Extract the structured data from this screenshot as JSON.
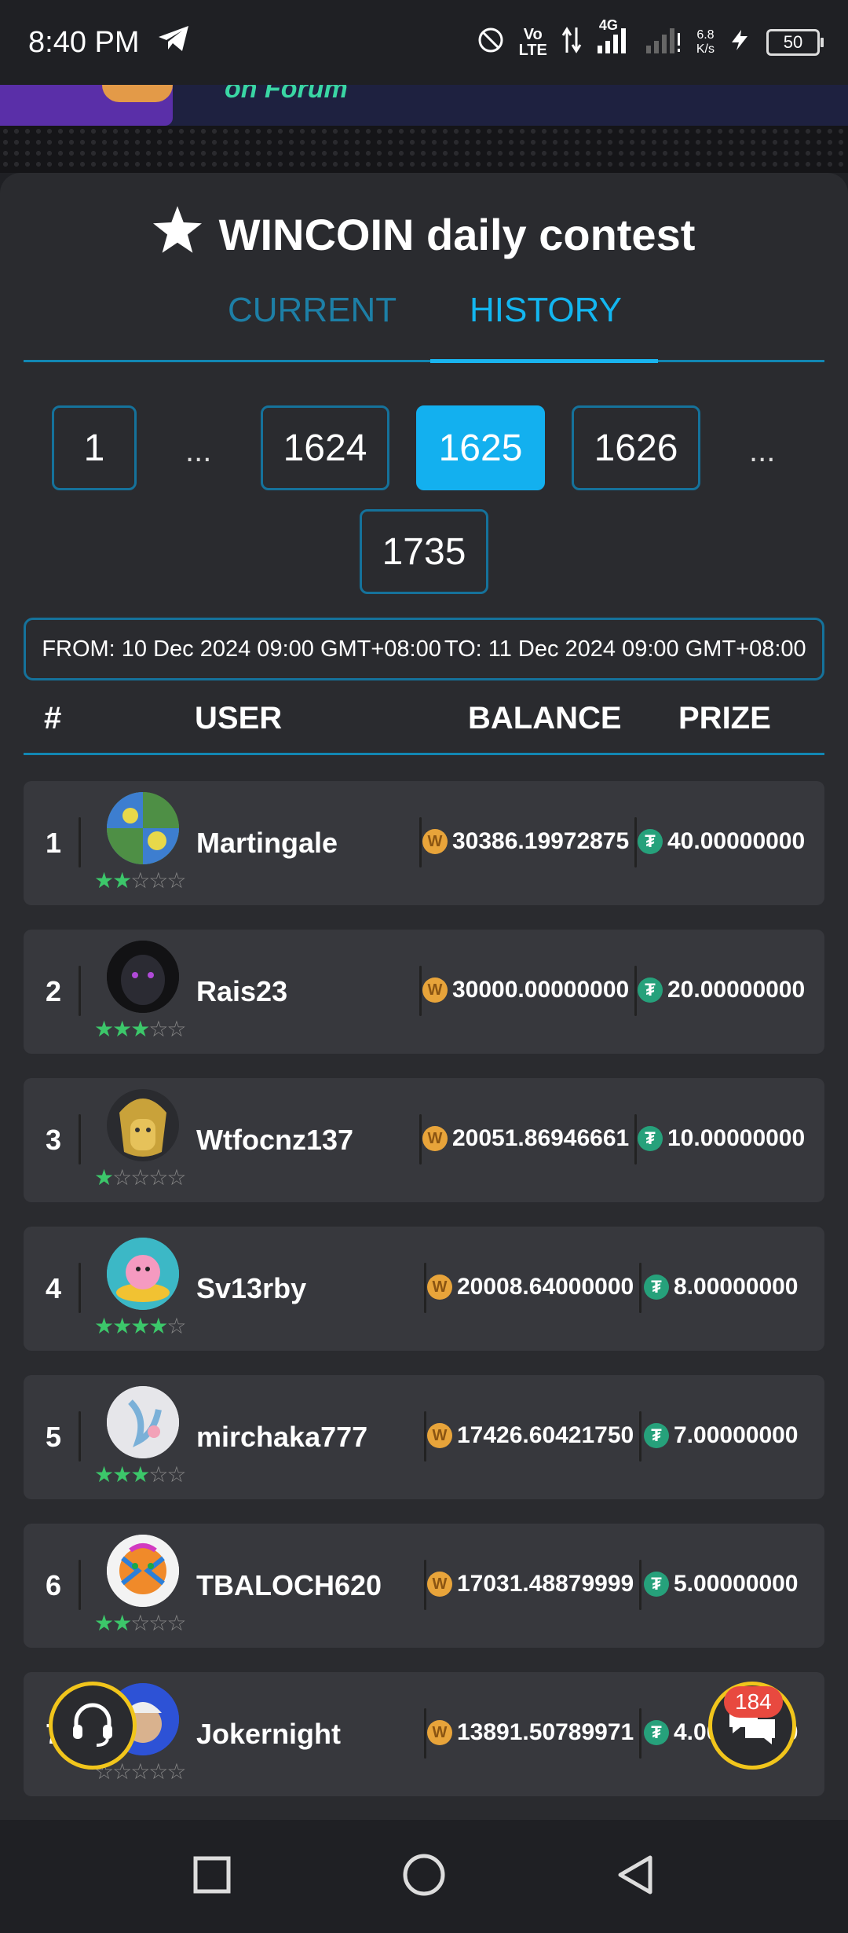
{
  "status_bar": {
    "time": "8:40 PM",
    "battery": "50",
    "network": "4G",
    "speed_value": "6.8",
    "speed_unit": "K/s"
  },
  "banner": {
    "text": "on Forum"
  },
  "contest": {
    "title": "WINCOIN daily contest"
  },
  "tabs": {
    "current": "CURRENT",
    "history": "HISTORY"
  },
  "pagination": {
    "first": "1",
    "ellipsis1": "...",
    "p1624": "1624",
    "p1625": "1625",
    "p1626": "1626",
    "ellipsis2": "...",
    "last": "1735"
  },
  "range": {
    "from": "FROM: 10 Dec 2024 09:00 GMT+08:00",
    "to": "TO: 11 Dec 2024 09:00 GMT+08:00"
  },
  "table_header": {
    "rank": "#",
    "user": "USER",
    "balance": "BALANCE",
    "prize": "PRIZE"
  },
  "rows": [
    {
      "rank": "1",
      "user": "Martingale",
      "balance": "30386.19972875",
      "prize": "40.00000000",
      "stars": 2
    },
    {
      "rank": "2",
      "user": "Rais23",
      "balance": "30000.00000000",
      "prize": "20.00000000",
      "stars": 3
    },
    {
      "rank": "3",
      "user": "Wtfocnz137",
      "balance": "20051.86946661",
      "prize": "10.00000000",
      "stars": 1
    },
    {
      "rank": "4",
      "user": "Sv13rby",
      "balance": "20008.64000000",
      "prize": "8.00000000",
      "stars": 4
    },
    {
      "rank": "5",
      "user": "mirchaka777",
      "balance": "17426.60421750",
      "prize": "7.00000000",
      "stars": 3
    },
    {
      "rank": "6",
      "user": "TBALOCH620",
      "balance": "17031.48879999",
      "prize": "5.00000000",
      "stars": 2
    },
    {
      "rank": "7",
      "user": "Jokernight",
      "balance": "13891.50789971",
      "prize": "4.00000000",
      "stars": 0
    }
  ],
  "chat": {
    "badge": "184"
  },
  "colors": {
    "accent": "#13b0ef",
    "star": "#3cc76a",
    "coin": "#e8a43a",
    "tether": "#26a17b",
    "fab_border": "#f1c51c"
  }
}
